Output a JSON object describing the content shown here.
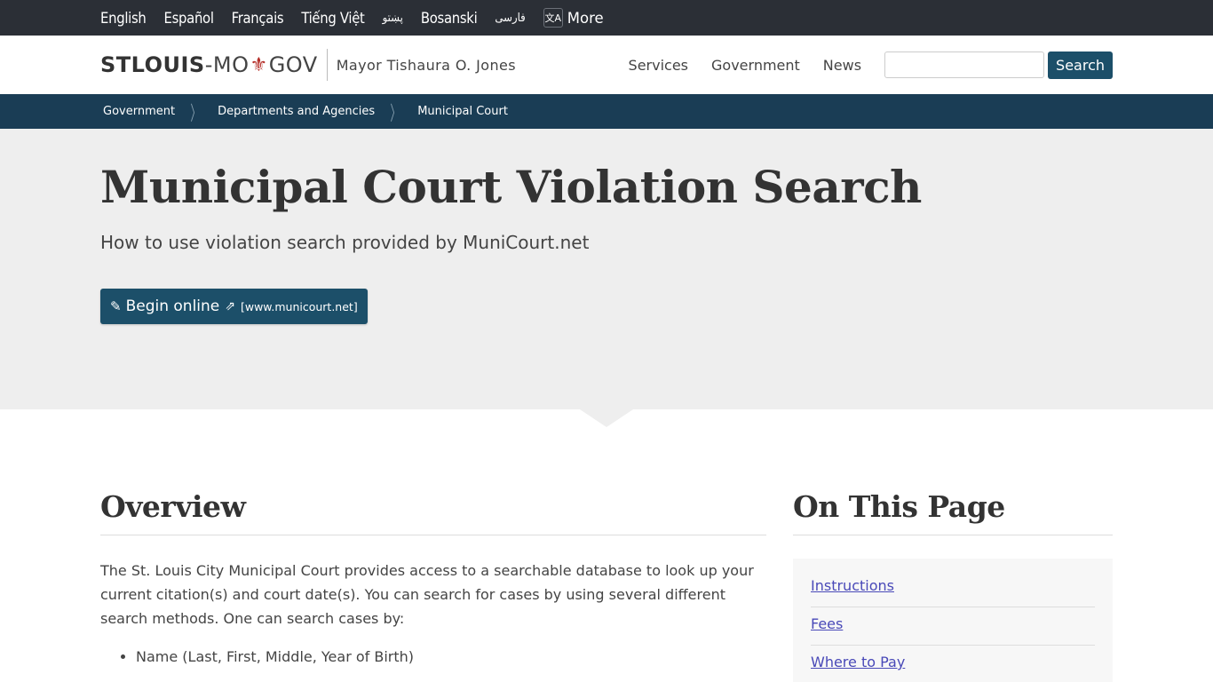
{
  "language_bar": {
    "languages": [
      "English",
      "Español",
      "Français",
      "Tiếng Việt",
      "پښتو",
      "Bosanski",
      "فارسی"
    ],
    "more_label": "More",
    "more_icon": "translate-icon"
  },
  "header": {
    "logo": {
      "part1": "STLOUIS",
      "part2": "-MO",
      "icon": "fleur-de-lis-icon",
      "part3": "GOV"
    },
    "mayor": "Mayor Tishaura O. Jones",
    "nav": [
      "Services",
      "Government",
      "News"
    ],
    "search": {
      "placeholder": "",
      "value": "",
      "button_label": "Search"
    }
  },
  "breadcrumb": [
    "Government",
    "Departments and Agencies",
    "Municipal Court"
  ],
  "hero": {
    "title": "Municipal Court Violation Search",
    "subtitle": "How to use violation search provided by MuniCourt.net",
    "button": {
      "label": "Begin online",
      "url_label": "[www.municourt.net]",
      "icon": "edit-icon",
      "external_icon": "external-link-icon"
    }
  },
  "overview": {
    "title": "Overview",
    "paragraph": "The St. Louis City Municipal Court provides access to a searchable database to look up your current citation(s) and court date(s). You can search for cases by using several different search methods. One can search cases by:",
    "list": [
      "Name (Last, First, Middle, Year of Birth)"
    ]
  },
  "on_this_page": {
    "title": "On This Page",
    "items": [
      "Instructions",
      "Fees",
      "Where to Pay"
    ]
  },
  "colors": {
    "lang_bar_bg": "#2b2f36",
    "brand_blue": "#1c4f69",
    "breadcrumb_bg": "#1a3d55",
    "hero_bg": "#eeeeee",
    "logo_accent": "#b5302a",
    "link": "#4949b8"
  }
}
